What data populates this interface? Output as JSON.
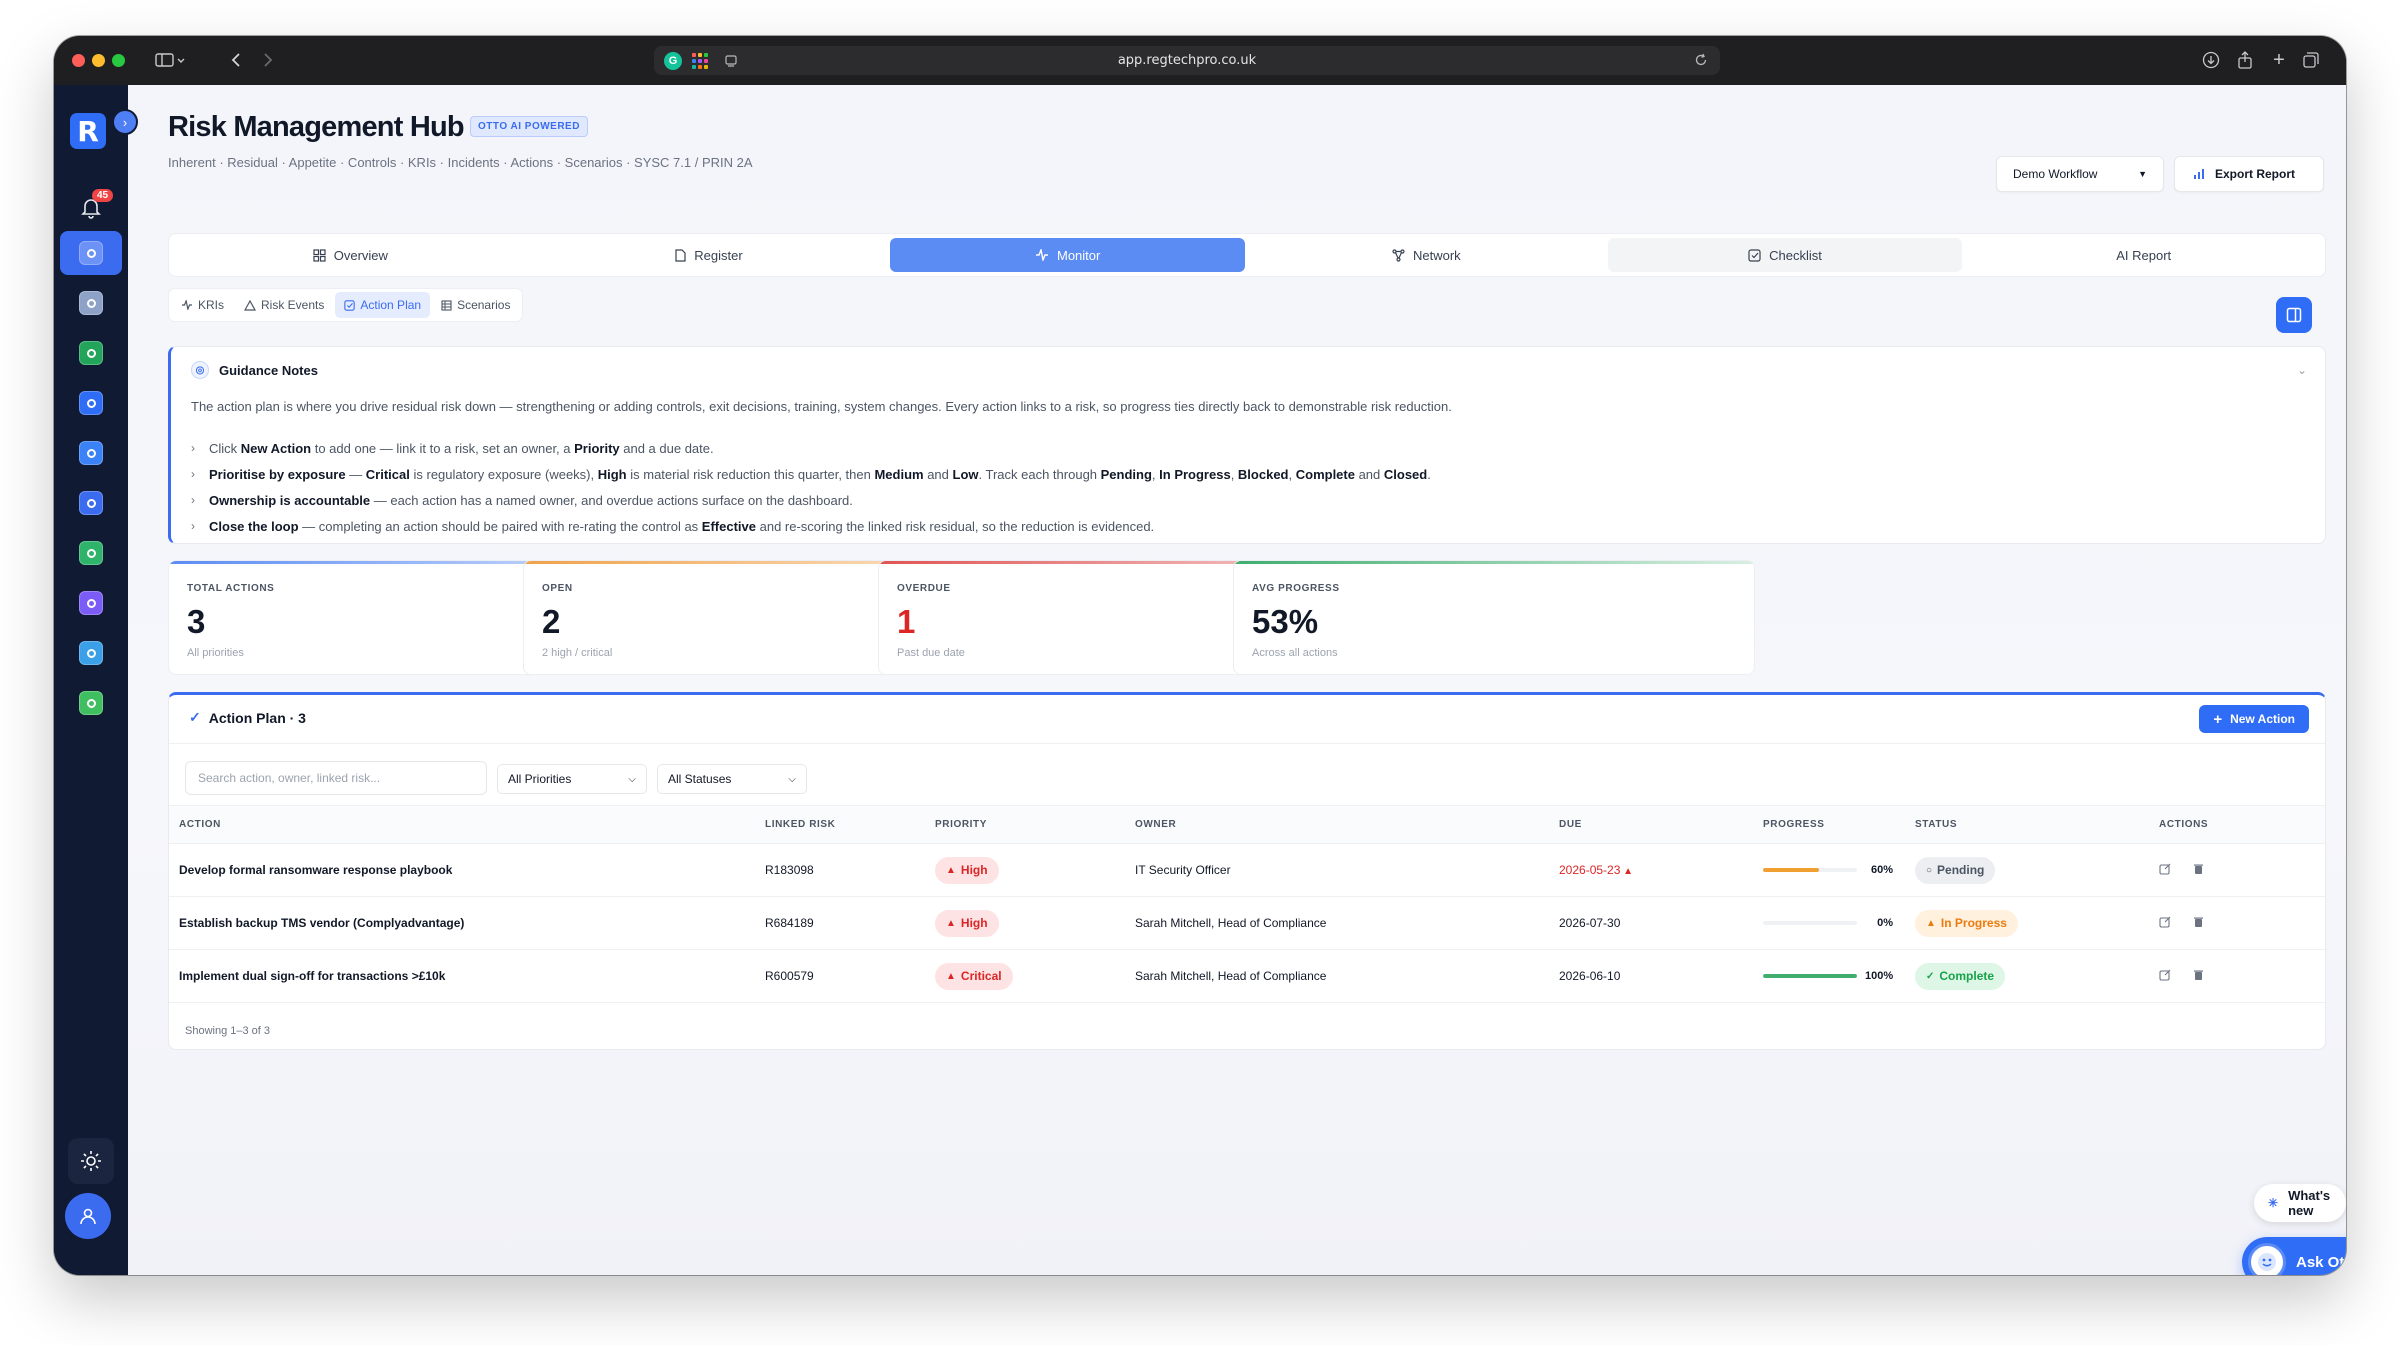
{
  "browser": {
    "url": "app.regtechpro.co.uk"
  },
  "sidebar": {
    "logo": "R",
    "notification_count": "45",
    "items": [
      {
        "icon": "shield-check-icon",
        "color": "#2f6df6",
        "active": true
      },
      {
        "icon": "dashboard-icon",
        "color": "#8ea2c7",
        "active": false
      },
      {
        "icon": "shield-green-icon",
        "color": "#22a55a",
        "active": false
      },
      {
        "icon": "target-icon",
        "color": "#2f6df6",
        "active": false
      },
      {
        "icon": "lock-shield-icon",
        "color": "#3b82f6",
        "active": false
      },
      {
        "icon": "network-icon",
        "color": "#3b6cf0",
        "active": false
      },
      {
        "icon": "bank-icon",
        "color": "#2fb36b",
        "active": false
      },
      {
        "icon": "list-icon",
        "color": "#7c5cf6",
        "active": false
      },
      {
        "icon": "chart-doc-icon",
        "color": "#3ba0e8",
        "active": false
      },
      {
        "icon": "card-icon",
        "color": "#3fbf5f",
        "active": false
      }
    ]
  },
  "header": {
    "title": "Risk Management Hub",
    "badge": "OTTO AI POWERED",
    "subtitle": "Inherent · Residual · Appetite · Controls · KRIs · Incidents · Actions · Scenarios · SYSC 7.1 / PRIN 2A",
    "workflow_select": "Demo Workflow",
    "export_label": "Export Report"
  },
  "tabs": [
    {
      "label": "Overview",
      "icon": "grid-icon"
    },
    {
      "label": "Register",
      "icon": "document-icon"
    },
    {
      "label": "Monitor",
      "icon": "activity-icon"
    },
    {
      "label": "Network",
      "icon": "network-icon"
    },
    {
      "label": "Checklist",
      "icon": "checkbox-icon"
    },
    {
      "label": "AI Report",
      "icon": ""
    }
  ],
  "subtabs": [
    {
      "label": "KRIs",
      "icon": "activity-icon"
    },
    {
      "label": "Risk Events",
      "icon": "warning-icon"
    },
    {
      "label": "Action Plan",
      "icon": "checkbox-icon"
    },
    {
      "label": "Scenarios",
      "icon": "table-icon"
    }
  ],
  "guidance": {
    "title": "Guidance Notes",
    "intro": "The action plan is where you drive residual risk down — strengthening or adding controls, exit decisions, training, system changes. Every action links to a risk, so progress ties directly back to demonstrable risk reduction.",
    "items": [
      {
        "parts": [
          [
            "Click ",
            false
          ],
          [
            "New Action",
            true
          ],
          [
            " to add one — link it to a risk, set an owner, a ",
            false
          ],
          [
            "Priority",
            true
          ],
          [
            " and a due date.",
            false
          ]
        ]
      },
      {
        "parts": [
          [
            "Prioritise by exposure",
            true
          ],
          [
            " — ",
            false
          ],
          [
            "Critical",
            true
          ],
          [
            " is regulatory exposure (weeks), ",
            false
          ],
          [
            "High",
            true
          ],
          [
            " is material risk reduction this quarter, then ",
            false
          ],
          [
            "Medium",
            true
          ],
          [
            " and ",
            false
          ],
          [
            "Low",
            true
          ],
          [
            ". Track each through ",
            false
          ],
          [
            "Pending",
            true
          ],
          [
            ", ",
            false
          ],
          [
            "In Progress",
            true
          ],
          [
            ", ",
            false
          ],
          [
            "Blocked",
            true
          ],
          [
            ", ",
            false
          ],
          [
            "Complete",
            true
          ],
          [
            " and ",
            false
          ],
          [
            "Closed",
            true
          ],
          [
            ".",
            false
          ]
        ]
      },
      {
        "parts": [
          [
            "Ownership is accountable",
            true
          ],
          [
            " — each action has a named owner, and overdue actions surface on the dashboard.",
            false
          ]
        ]
      },
      {
        "parts": [
          [
            "Close the loop",
            true
          ],
          [
            " — completing an action should be paired with re-rating the control as ",
            false
          ],
          [
            "Effective",
            true
          ],
          [
            " and re-scoring the linked risk residual, so the reduction is evidenced.",
            false
          ]
        ]
      }
    ]
  },
  "stats": [
    {
      "label": "TOTAL ACTIONS",
      "value": "3",
      "note": "All priorities",
      "accent": "#5b8cf4",
      "value_color": "#111827"
    },
    {
      "label": "OPEN",
      "value": "2",
      "note": "2 high / critical",
      "accent": "#f0a24a",
      "value_color": "#111827"
    },
    {
      "label": "OVERDUE",
      "value": "1",
      "note": "Past due date",
      "accent": "#e05454",
      "value_color": "#dc2626"
    },
    {
      "label": "AVG PROGRESS",
      "value": "53%",
      "note": "Across all actions",
      "accent": "#3fae6f",
      "value_color": "#111827"
    }
  ],
  "plan": {
    "title": "Action Plan · 3",
    "new_action": "New Action",
    "search_placeholder": "Search action, owner, linked risk...",
    "priority_filter": "All Priorities",
    "status_filter": "All Statuses",
    "columns": [
      "ACTION",
      "LINKED RISK",
      "PRIORITY",
      "OWNER",
      "DUE",
      "PROGRESS",
      "STATUS",
      "ACTIONS"
    ],
    "rows": [
      {
        "action": "Develop formal ransomware response playbook",
        "risk": "R183098",
        "priority": "High",
        "owner": "IT Security Officer",
        "due": "2026-05-23",
        "overdue": true,
        "progress": 60,
        "progress_label": "60%",
        "progress_color": "#f0a030",
        "status": "Pending",
        "status_class": "pill-grey",
        "status_icon": "○"
      },
      {
        "action": "Establish backup TMS vendor (Complyadvantage)",
        "risk": "R684189",
        "priority": "High",
        "owner": "Sarah Mitchell, Head of Compliance",
        "due": "2026-07-30",
        "overdue": false,
        "progress": 0,
        "progress_label": "0%",
        "progress_color": "#f0a030",
        "status": "In Progress",
        "status_class": "pill-orange",
        "status_icon": "▲"
      },
      {
        "action": "Implement dual sign-off for transactions >£10k",
        "risk": "R600579",
        "priority": "Critical",
        "owner": "Sarah Mitchell, Head of Compliance",
        "due": "2026-06-10",
        "overdue": false,
        "progress": 100,
        "progress_label": "100%",
        "progress_color": "#3fae6f",
        "status": "Complete",
        "status_class": "pill-green",
        "status_icon": "✓"
      }
    ],
    "showing": "Showing 1–3 of 3"
  },
  "floating": {
    "whats_new": "What's new",
    "ask_otto": "Ask Otto"
  }
}
